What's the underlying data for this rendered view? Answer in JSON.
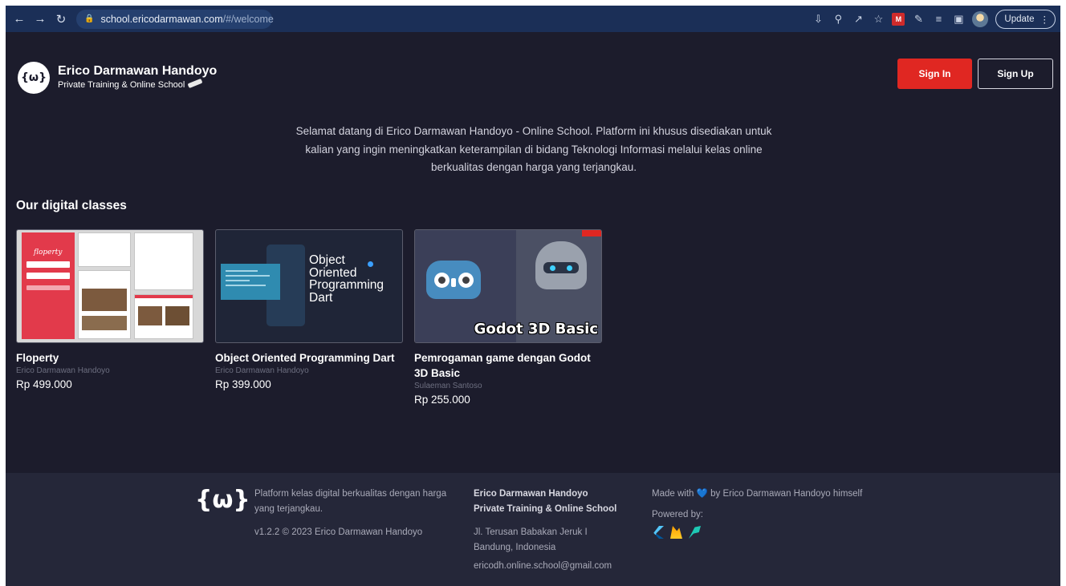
{
  "browser": {
    "url_host": "school.ericodarmawan.com",
    "url_path": "/#/welcome",
    "update_label": "Update",
    "extension_badge": "M"
  },
  "header": {
    "logo_text": "{ω}",
    "brand_title": "Erico Darmawan Handoyo",
    "brand_subtitle": "Private Training & Online School",
    "sign_in_label": "Sign In",
    "sign_up_label": "Sign Up",
    "sign_in_color": "#e02722"
  },
  "welcome_text": "Selamat datang di Erico Darmawan Handoyo - Online School. Platform ini khusus disediakan untuk kalian yang ingin meningkatkan keterampilan di bidang Teknologi Informasi melalui kelas online berkualitas dengan harga yang terjangkau.",
  "classes": {
    "section_title": "Our digital classes",
    "items": [
      {
        "title": "Floperty",
        "author": "Erico Darmawan Handoyo",
        "price": "Rp 499.000",
        "thumb_logo": "floperty"
      },
      {
        "title": "Object Oriented Programming Dart",
        "author": "Erico Darmawan Handoyo",
        "price": "Rp 399.000",
        "thumb_line1": "Object",
        "thumb_line2": "Oriented",
        "thumb_line3": "Programming",
        "thumb_line4": "Dart"
      },
      {
        "title": "Pemrogaman game dengan Godot 3D Basic",
        "author": "Sulaeman Santoso",
        "price": "Rp 255.000",
        "thumb_label": "Godot 3D Basic"
      }
    ]
  },
  "footer": {
    "logo_text": "{ω}",
    "tagline": "Platform kelas digital berkualitas dengan harga yang terjangkau.",
    "version": "v1.2.2 © 2023 Erico Darmawan Handoyo",
    "org_name": "Erico Darmawan Handoyo",
    "org_subtitle": "Private Training & Online School",
    "address_line1": "Jl. Terusan Babakan Jeruk I",
    "address_line2": "Bandung, Indonesia",
    "email": "ericodh.online.school@gmail.com",
    "made_with": "Made with 💙 by Erico Darmawan Handoyo himself",
    "powered_by": "Powered by:",
    "powered_icons": [
      "flutter-icon",
      "firebase-icon",
      "hosting-icon"
    ]
  }
}
